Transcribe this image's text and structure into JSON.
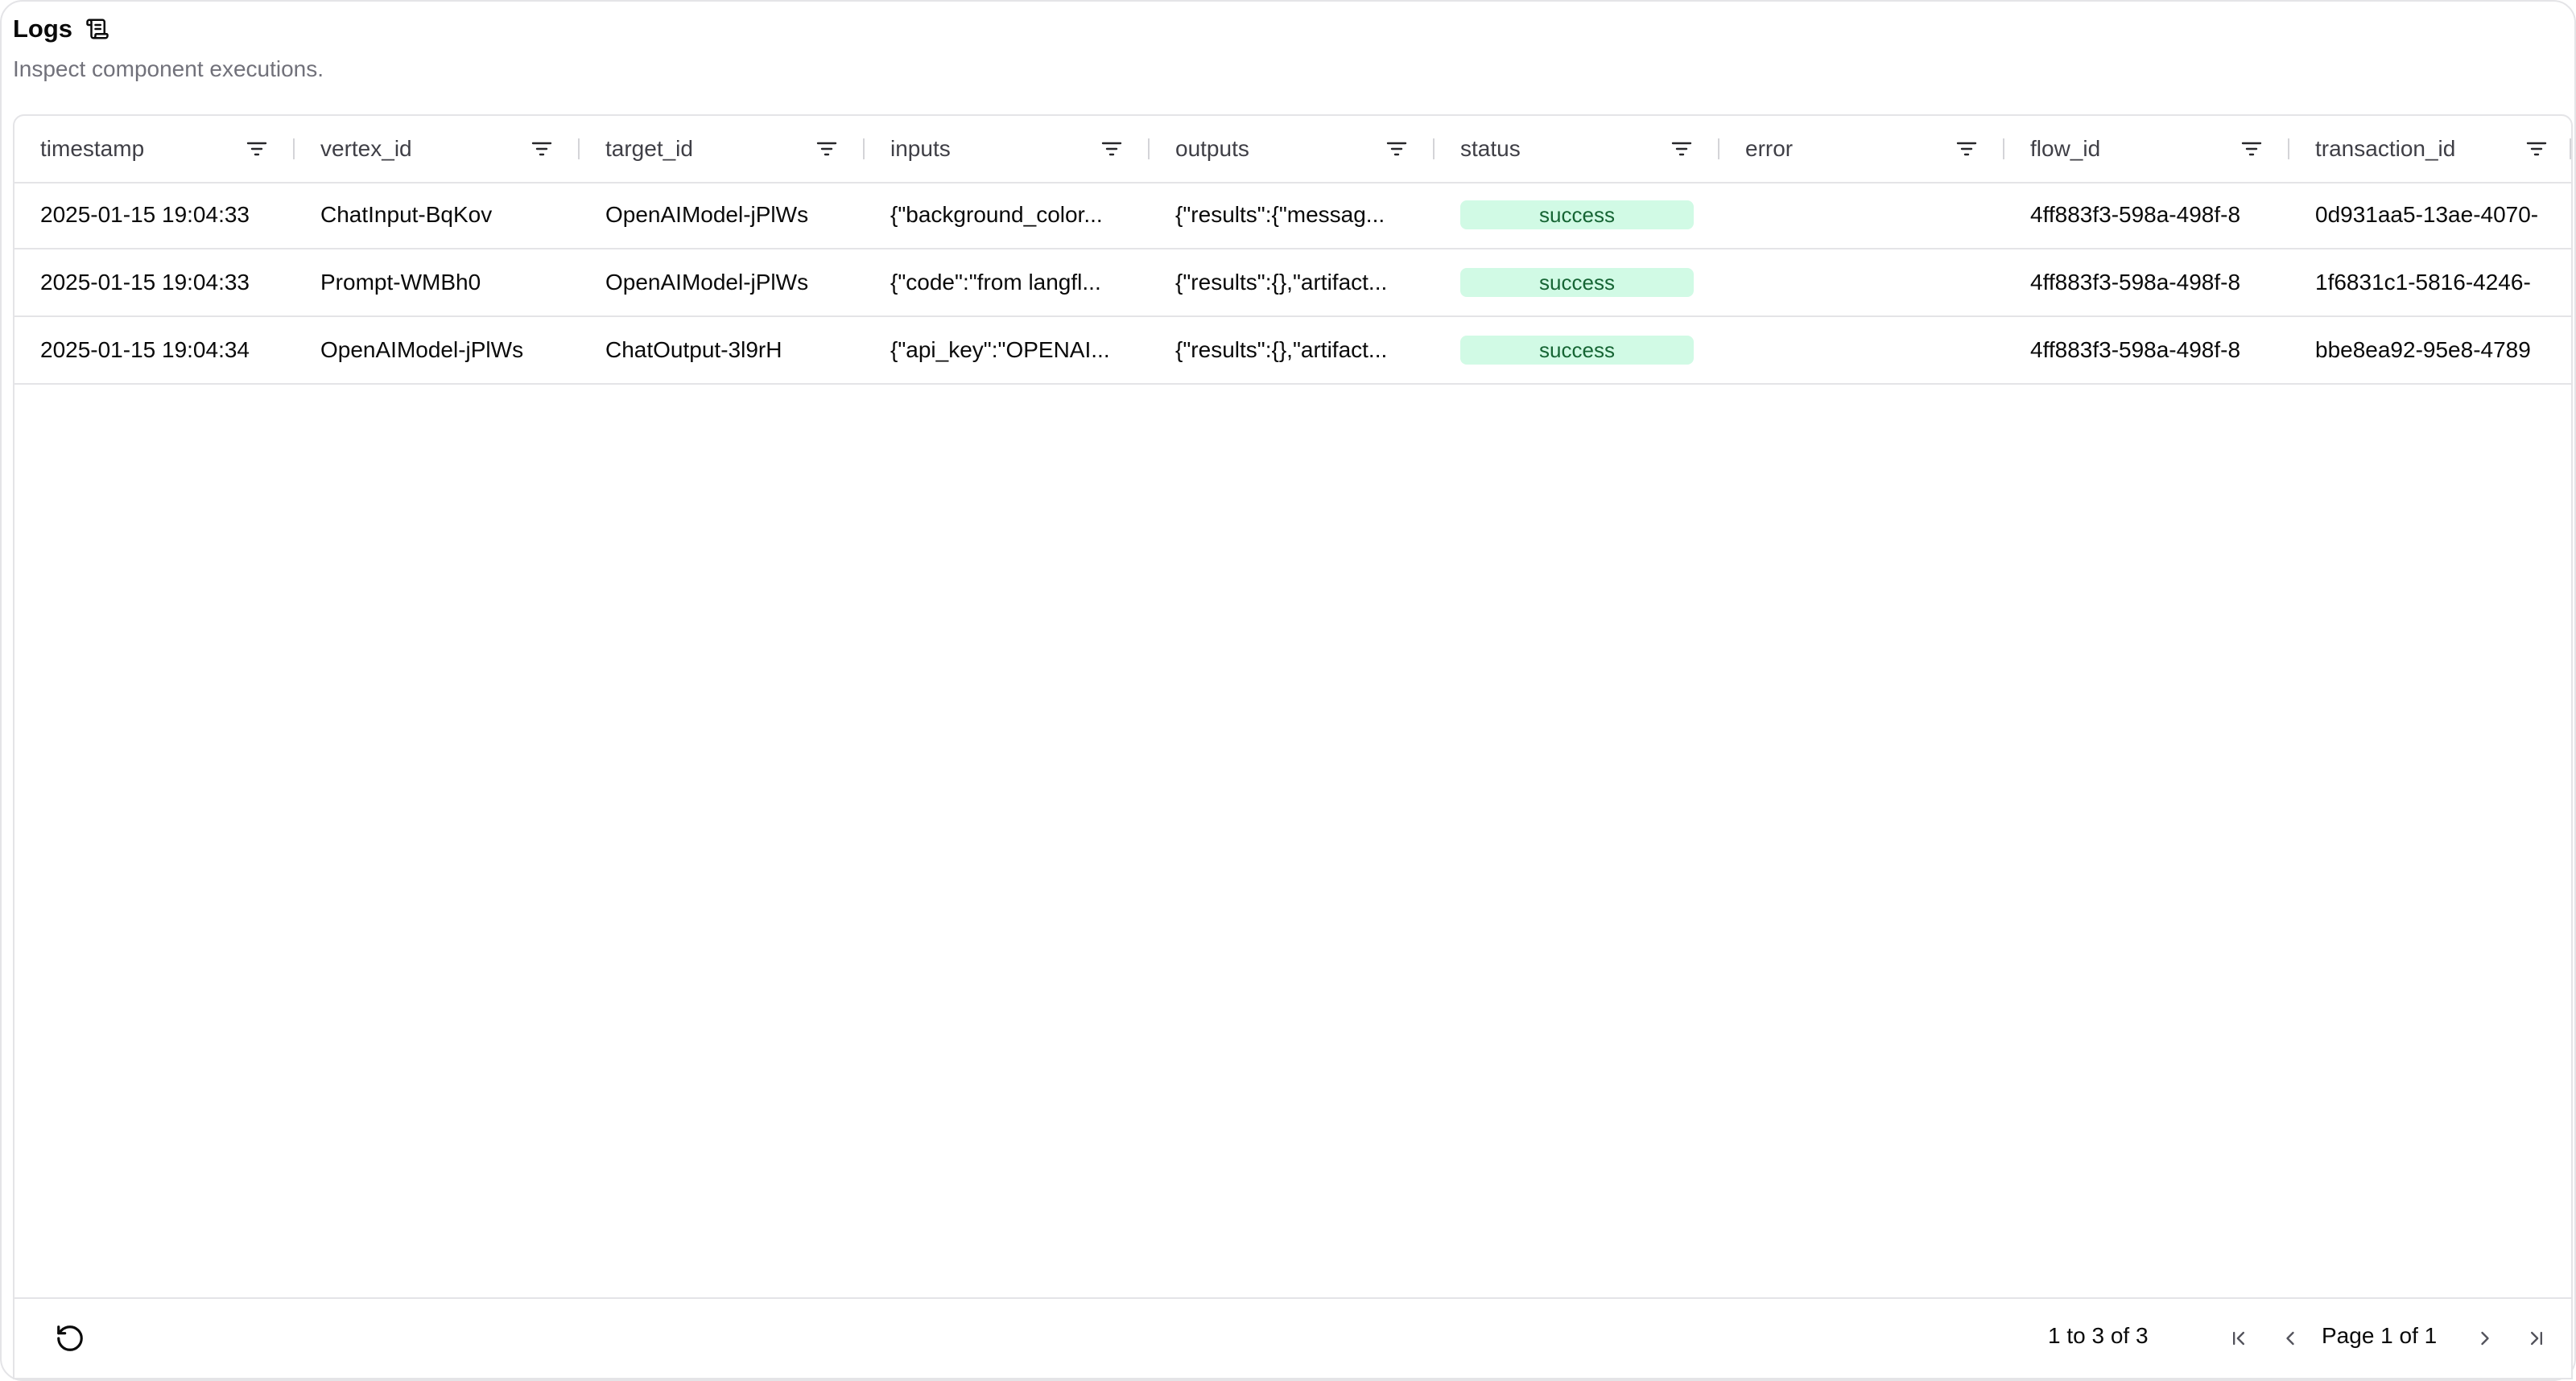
{
  "header": {
    "title": "Logs",
    "title_icon": "scroll-text-icon",
    "subtitle": "Inspect component executions."
  },
  "table": {
    "columns": [
      {
        "key": "timestamp",
        "label": "timestamp"
      },
      {
        "key": "vertex_id",
        "label": "vertex_id"
      },
      {
        "key": "target_id",
        "label": "target_id"
      },
      {
        "key": "inputs",
        "label": "inputs"
      },
      {
        "key": "outputs",
        "label": "outputs"
      },
      {
        "key": "status",
        "label": "status"
      },
      {
        "key": "error",
        "label": "error"
      },
      {
        "key": "flow_id",
        "label": "flow_id"
      },
      {
        "key": "transaction_id",
        "label": "transaction_id"
      }
    ],
    "rows": [
      {
        "timestamp": "2025-01-15 19:04:33",
        "vertex_id": "ChatInput-BqKov",
        "target_id": "OpenAIModel-jPlWs",
        "inputs": "{\"background_color...",
        "outputs": "{\"results\":{\"messag...",
        "status": "success",
        "error": "",
        "flow_id": "4ff883f3-598a-498f-8",
        "transaction_id": "0d931aa5-13ae-4070-"
      },
      {
        "timestamp": "2025-01-15 19:04:33",
        "vertex_id": "Prompt-WMBh0",
        "target_id": "OpenAIModel-jPlWs",
        "inputs": "{\"code\":\"from langfl...",
        "outputs": "{\"results\":{},\"artifact...",
        "status": "success",
        "error": "",
        "flow_id": "4ff883f3-598a-498f-8",
        "transaction_id": "1f6831c1-5816-4246-"
      },
      {
        "timestamp": "2025-01-15 19:04:34",
        "vertex_id": "OpenAIModel-jPlWs",
        "target_id": "ChatOutput-3l9rH",
        "inputs": "{\"api_key\":\"OPENAI...",
        "outputs": "{\"results\":{},\"artifact...",
        "status": "success",
        "error": "",
        "flow_id": "4ff883f3-598a-498f-8",
        "transaction_id": "bbe8ea92-95e8-4789"
      }
    ]
  },
  "footer": {
    "range_text": "1 to 3 of 3",
    "page_text": "Page 1 of 1",
    "icons": {
      "refresh": "refresh-icon",
      "first": "first-page-icon",
      "prev": "previous-page-icon",
      "next": "next-page-icon",
      "last": "last-page-icon"
    }
  },
  "colors": {
    "border": "#e4e4e7",
    "success_bg": "#d1fae5",
    "success_text": "#166534",
    "muted_text": "#71717a"
  }
}
